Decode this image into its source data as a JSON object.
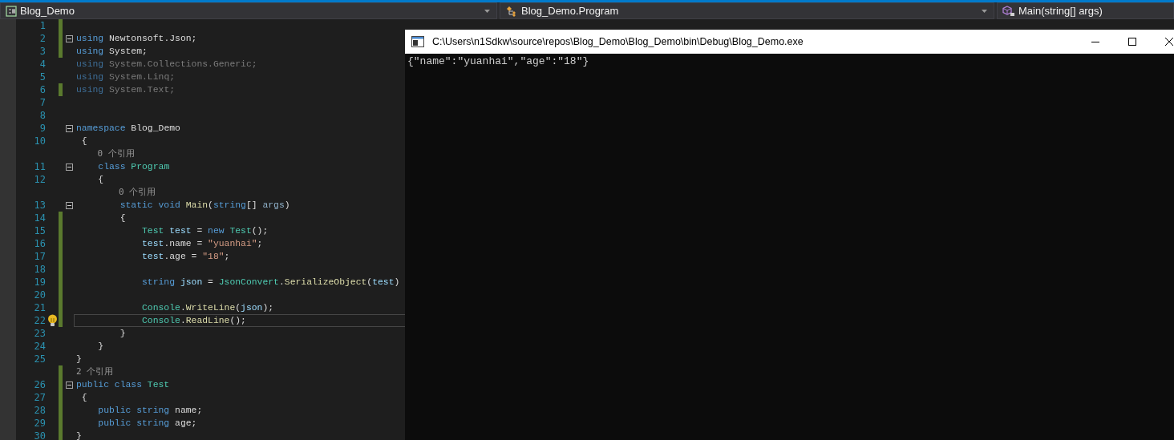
{
  "navigation_bar": {
    "dropdowns": [
      {
        "kind": "project",
        "label": "Blog_Demo",
        "arrow": true
      },
      {
        "kind": "class",
        "label": "Blog_Demo.Program",
        "arrow": true
      },
      {
        "kind": "method",
        "label": "Main(string[] args)"
      }
    ]
  },
  "editor": {
    "lines": [
      {
        "kind": "code",
        "number": "1",
        "modified": true
      },
      {
        "kind": "code",
        "number": "2",
        "modified": true,
        "fold": true,
        "tokens": [
          {
            "kind": "kw",
            "text": "using"
          },
          {
            "kind": "plain",
            "text": " Newtonsoft.Json;"
          }
        ]
      },
      {
        "kind": "code",
        "number": "3",
        "modified": true,
        "tokens": [
          {
            "kind": "kw",
            "text": "using"
          },
          {
            "kind": "plain",
            "text": " System;"
          }
        ]
      },
      {
        "kind": "code",
        "number": "4",
        "modified": false,
        "tokens": [
          {
            "kind": "faded-kw",
            "text": "using"
          },
          {
            "kind": "faded",
            "text": " System.Collections.Generic;"
          }
        ]
      },
      {
        "kind": "code",
        "number": "5",
        "modified": false,
        "tokens": [
          {
            "kind": "faded-kw",
            "text": "using"
          },
          {
            "kind": "faded",
            "text": " System.Linq;"
          }
        ]
      },
      {
        "kind": "code",
        "number": "6",
        "modified": true,
        "tokens": [
          {
            "kind": "faded-kw",
            "text": "using"
          },
          {
            "kind": "faded",
            "text": " System.Text;"
          }
        ]
      },
      {
        "kind": "code",
        "number": "7",
        "modified": false
      },
      {
        "kind": "code",
        "number": "8",
        "modified": false
      },
      {
        "kind": "code",
        "number": "9",
        "modified": false,
        "fold": true,
        "tokens": [
          {
            "kind": "kw",
            "text": "namespace"
          },
          {
            "kind": "plain",
            "text": " Blog_Demo"
          }
        ]
      },
      {
        "kind": "code",
        "number": "10",
        "modified": false,
        "tokens": [
          {
            "kind": "plain",
            "text": " {"
          }
        ]
      },
      {
        "kind": "lens",
        "text": "    0 个引用",
        "modified": false
      },
      {
        "kind": "code",
        "number": "11",
        "modified": false,
        "fold": true,
        "tokens": [
          {
            "kind": "kw",
            "text": "    class"
          },
          {
            "kind": "type",
            "text": " Program"
          }
        ]
      },
      {
        "kind": "code",
        "number": "12",
        "modified": false,
        "tokens": [
          {
            "kind": "plain",
            "text": "    {"
          }
        ]
      },
      {
        "kind": "lens",
        "text": "        0 个引用",
        "modified": false
      },
      {
        "kind": "code",
        "number": "13",
        "modified": false,
        "fold": true,
        "tokens": [
          {
            "kind": "kw",
            "text": "        static void"
          },
          {
            "kind": "method",
            "text": " Main"
          },
          {
            "kind": "plain",
            "text": "("
          },
          {
            "kind": "kw",
            "text": "string"
          },
          {
            "kind": "plain",
            "text": "[] "
          },
          {
            "kind": "param",
            "text": "args"
          },
          {
            "kind": "plain",
            "text": ")"
          }
        ]
      },
      {
        "kind": "code",
        "number": "14",
        "modified": true,
        "tokens": [
          {
            "kind": "plain",
            "text": "        {"
          }
        ]
      },
      {
        "kind": "code",
        "number": "15",
        "modified": true,
        "tokens": [
          {
            "kind": "type",
            "text": "            Test"
          },
          {
            "kind": "var",
            "text": " test"
          },
          {
            "kind": "plain",
            "text": " = "
          },
          {
            "kind": "kw",
            "text": "new"
          },
          {
            "kind": "type",
            "text": " Test"
          },
          {
            "kind": "plain",
            "text": "();"
          }
        ]
      },
      {
        "kind": "code",
        "number": "16",
        "modified": true,
        "tokens": [
          {
            "kind": "var",
            "text": "            test"
          },
          {
            "kind": "plain",
            "text": ".name = "
          },
          {
            "kind": "str",
            "text": "\"yuanhai\""
          },
          {
            "kind": "plain",
            "text": ";"
          }
        ]
      },
      {
        "kind": "code",
        "number": "17",
        "modified": true,
        "tokens": [
          {
            "kind": "var",
            "text": "            test"
          },
          {
            "kind": "plain",
            "text": ".age = "
          },
          {
            "kind": "str",
            "text": "\"18\""
          },
          {
            "kind": "plain",
            "text": ";"
          }
        ]
      },
      {
        "kind": "code",
        "number": "18",
        "modified": true
      },
      {
        "kind": "code",
        "number": "19",
        "modified": true,
        "tokens": [
          {
            "kind": "kw",
            "text": "            string"
          },
          {
            "kind": "var",
            "text": " json"
          },
          {
            "kind": "plain",
            "text": " = "
          },
          {
            "kind": "type",
            "text": "JsonConvert"
          },
          {
            "kind": "plain",
            "text": "."
          },
          {
            "kind": "method",
            "text": "SerializeObject"
          },
          {
            "kind": "plain",
            "text": "("
          },
          {
            "kind": "var",
            "text": "test"
          },
          {
            "kind": "plain",
            "text": ")"
          }
        ]
      },
      {
        "kind": "code",
        "number": "20",
        "modified": true
      },
      {
        "kind": "code",
        "number": "21",
        "modified": true,
        "tokens": [
          {
            "kind": "type",
            "text": "            Console"
          },
          {
            "kind": "plain",
            "text": "."
          },
          {
            "kind": "method",
            "text": "WriteLine"
          },
          {
            "kind": "plain",
            "text": "("
          },
          {
            "kind": "var",
            "text": "json"
          },
          {
            "kind": "plain",
            "text": ");"
          }
        ]
      },
      {
        "kind": "code",
        "number": "22",
        "modified": true,
        "current": true,
        "lightbulb": true,
        "tokens": [
          {
            "kind": "type",
            "text": "            Console"
          },
          {
            "kind": "plain",
            "text": "."
          },
          {
            "kind": "method",
            "text": "ReadLine"
          },
          {
            "kind": "plain",
            "text": "();"
          }
        ]
      },
      {
        "kind": "code",
        "number": "23",
        "modified": false,
        "tokens": [
          {
            "kind": "plain",
            "text": "        }"
          }
        ]
      },
      {
        "kind": "code",
        "number": "24",
        "modified": false,
        "tokens": [
          {
            "kind": "plain",
            "text": "    }"
          }
        ]
      },
      {
        "kind": "code",
        "number": "25",
        "modified": false,
        "tokens": [
          {
            "kind": "plain",
            "text": "}"
          }
        ]
      },
      {
        "kind": "lens",
        "text": "2 个引用",
        "modified": true
      },
      {
        "kind": "code",
        "number": "26",
        "modified": true,
        "fold": true,
        "tokens": [
          {
            "kind": "kw",
            "text": "public class"
          },
          {
            "kind": "type",
            "text": " Test"
          }
        ]
      },
      {
        "kind": "code",
        "number": "27",
        "modified": true,
        "tokens": [
          {
            "kind": "plain",
            "text": " {"
          }
        ]
      },
      {
        "kind": "code",
        "number": "28",
        "modified": true,
        "tokens": [
          {
            "kind": "kw",
            "text": "    public string"
          },
          {
            "kind": "plain",
            "text": " name;"
          }
        ]
      },
      {
        "kind": "code",
        "number": "29",
        "modified": true,
        "tokens": [
          {
            "kind": "kw",
            "text": "    public string"
          },
          {
            "kind": "plain",
            "text": " age;"
          }
        ]
      },
      {
        "kind": "code",
        "number": "30",
        "modified": true,
        "tokens": [
          {
            "kind": "plain",
            "text": "}"
          }
        ]
      }
    ]
  },
  "console_window": {
    "title": "C:\\Users\\n1Sdkw\\source\\repos\\Blog_Demo\\Blog_Demo\\bin\\Debug\\Blog_Demo.exe",
    "output": [
      "{\"name\":\"yuanhai\",\"age\":\"18\"}"
    ]
  }
}
